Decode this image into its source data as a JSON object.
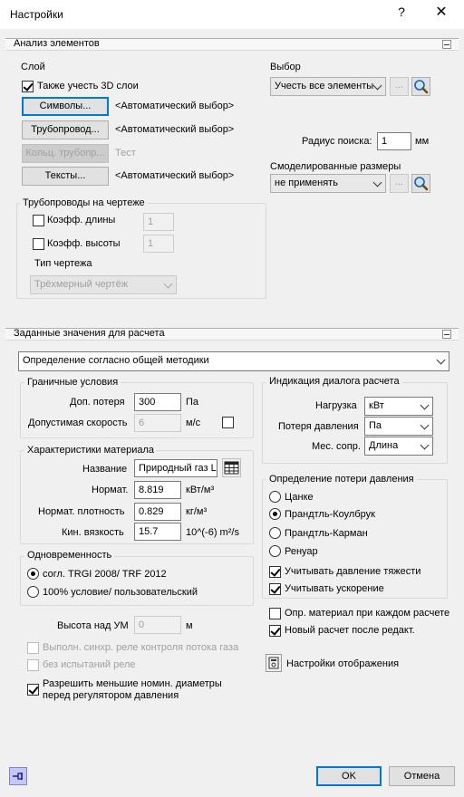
{
  "window": {
    "title": "Настройки",
    "help": "?",
    "close": "✕"
  },
  "analysis": {
    "header": "Анализ элементов",
    "layer": {
      "title": "Слой",
      "also_3d": "Также учесть 3D слои",
      "symbols_btn": "Символы...",
      "symbols_val": "<Автоматический выбор>",
      "pipes_btn": "Трубопровод...",
      "pipes_val": "<Автоматический выбор>",
      "ring_btn": "Кольц. трубопр...",
      "ring_val": "Тест",
      "texts_btn": "Тексты...",
      "texts_val": "<Автоматический выбор>"
    },
    "selection": {
      "title": "Выбор",
      "combo": "Учесть все элементы",
      "dots": "...",
      "radius_label": "Радиус поиска:",
      "radius_value": "1",
      "radius_unit": "мм",
      "modeled_title": "Смоделированные размеры",
      "modeled_combo": "не применять"
    },
    "pipes_drawing": {
      "title": "Трубопроводы на чертеже",
      "len_coef": "Коэфф. длины",
      "len_value": "1",
      "height_coef": "Коэфф. высоты",
      "height_value": "1",
      "drawing_type": "Тип чертежа",
      "drawing_combo": "Трёхмерный чертёж"
    }
  },
  "calc": {
    "header": "Заданные значения для расчета",
    "method_combo": "Определение согласно общей методики",
    "boundary": {
      "title": "Граничные условия",
      "loss_label": "Доп. потеря",
      "loss_value": "300",
      "loss_unit": "Па",
      "speed_label": "Допустимая скорость",
      "speed_value": "6",
      "speed_unit": "м/с"
    },
    "material": {
      "title": "Характеристики материала",
      "name_label": "Название",
      "name_value": "Природный газ L",
      "norm_label": "Нормат.",
      "norm_value": "8.819",
      "norm_unit": "кВт/м³",
      "density_label": "Нормат. плотность",
      "density_value": "0.829",
      "density_unit": "кг/м³",
      "visc_label": "Кин. вязкость",
      "visc_value": "15.7",
      "visc_unit": "10^(-6) m²/s"
    },
    "simultaneity": {
      "title": "Одновременность",
      "opt1": "согл. TRGI 2008/ TRF 2012",
      "opt2": "100% условие/ пользовательский"
    },
    "height_label": "Высота над УМ",
    "height_value": "0",
    "height_unit": "м",
    "sync_relay": "Выполн. синхр. реле контроля потока газа",
    "no_test_relay": "без испытаний реле",
    "allow_smaller": "Разрешить меньшие номин. диаметры перед регулятором давления",
    "indication": {
      "title": "Индикация диалога расчета",
      "load_label": "Нагрузка",
      "load_value": "кВт",
      "pressure_label": "Потеря давления",
      "pressure_value": "Па",
      "local_label": "Мес. сопр.",
      "local_value": "Длина"
    },
    "pressure_loss": {
      "title": "Определение потери давления",
      "opt1": "Цанке",
      "opt2": "Прандтль-Коулбрук",
      "opt3": "Прандтль-Карман",
      "opt4": "Ренуар",
      "gravity": "Учитывать давление тяжести",
      "accel": "Учитывать ускорение"
    },
    "material_each": "Опр. материал при каждом расчете",
    "recalc": "Новый расчет после редакт.",
    "display_settings": "Настройки отображения"
  },
  "footer": {
    "ok": "OK",
    "cancel": "Отмена"
  }
}
